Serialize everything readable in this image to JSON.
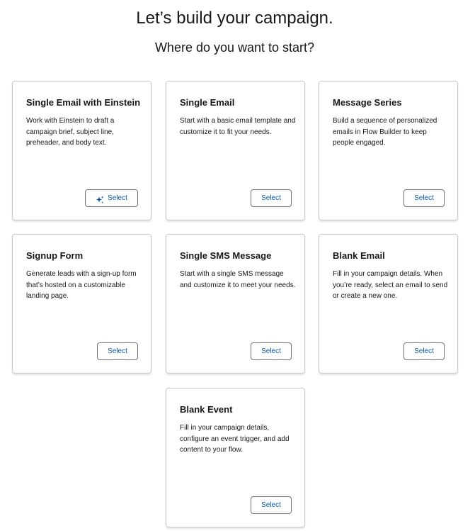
{
  "header": {
    "title": "Let’s build your campaign.",
    "subtitle": "Where do you want to start?"
  },
  "cards": [
    {
      "title": "Single Email with Einstein",
      "description": "Work with Einstein to draft a campaign brief, subject line, preheader, and body text.",
      "button_label": "Select",
      "button_icon": "einstein-sparkle-icon"
    },
    {
      "title": "Single Email",
      "description": "Start with a basic email template and customize it to fit your needs.",
      "button_label": "Select"
    },
    {
      "title": "Message Series",
      "description": "Build a sequence of personalized emails in Flow Builder to keep people engaged.",
      "button_label": "Select"
    },
    {
      "title": "Signup Form",
      "description": "Generate leads with a sign-up form that’s hosted on a customizable landing page.",
      "button_label": "Select"
    },
    {
      "title": "Single SMS Message",
      "description": "Start with a single SMS message and customize it to meet your needs.",
      "button_label": "Select"
    },
    {
      "title": "Blank Email",
      "description": "Fill in your campaign details. When you’re ready, select an email to send or create a new one.",
      "button_label": "Select"
    },
    {
      "title": "Blank Event",
      "description": "Fill in your campaign details, configure an event trigger, and add content to your flow.",
      "button_label": "Select"
    }
  ],
  "colors": {
    "button_text": "#0b5cab",
    "button_border": "#747474",
    "card_border": "#c9c9c9",
    "text": "#181818"
  }
}
